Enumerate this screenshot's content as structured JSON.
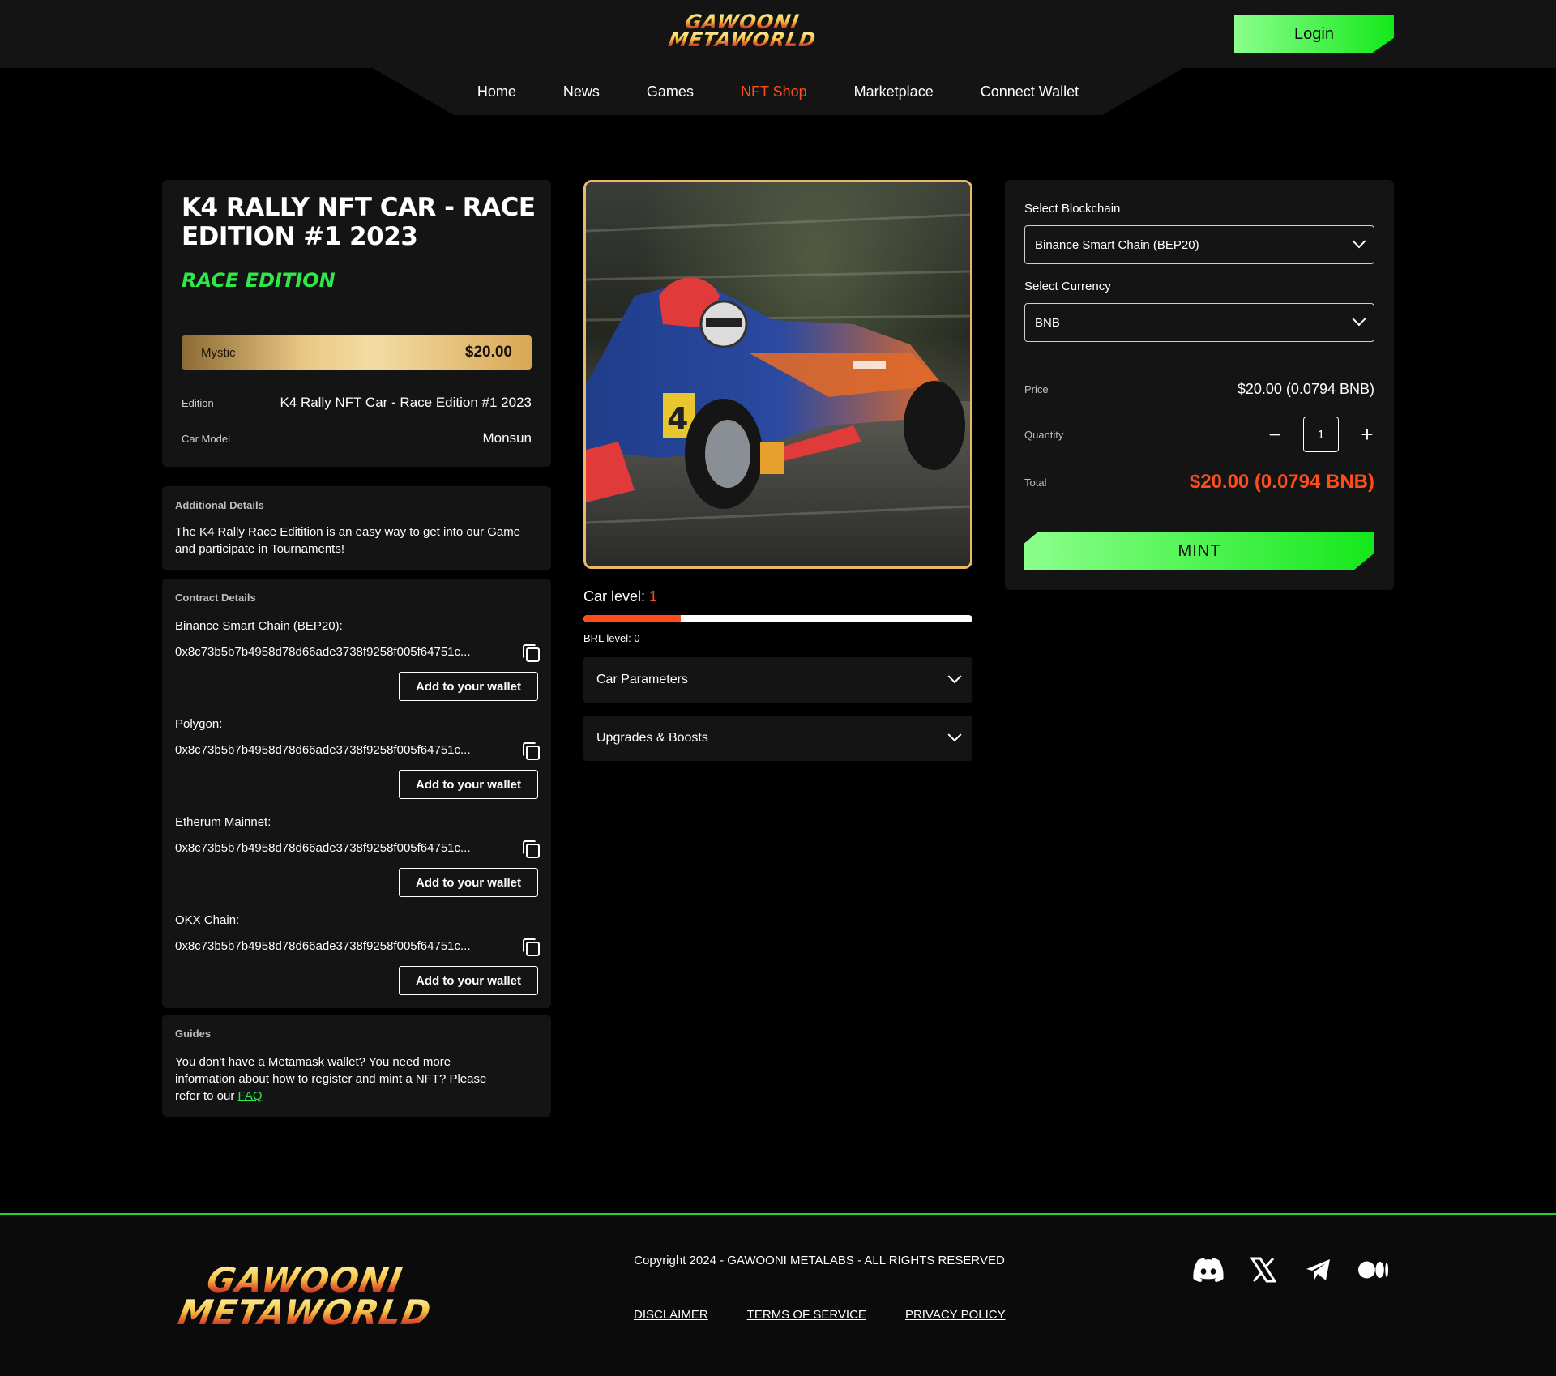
{
  "brand": {
    "logo_line1": "GAWOONI",
    "logo_line2": "METAWORLD"
  },
  "header": {
    "login_label": "Login"
  },
  "nav": {
    "items": [
      "Home",
      "News",
      "Games",
      "NFT Shop",
      "Marketplace",
      "Connect Wallet"
    ],
    "active": "NFT Shop"
  },
  "product": {
    "title": "K4 RALLY NFT CAR - RACE EDITION #1 2023",
    "edition_tag": "RACE EDITION",
    "rarity_name": "Mystic",
    "rarity_price": "$20.00",
    "edition_label": "Edition",
    "edition_value": "K4 Rally NFT Car - Race Edition #1 2023",
    "model_label": "Car Model",
    "model_value": "Monsun"
  },
  "additional": {
    "label": "Additional Details",
    "text": "The K4 Rally Race Editition is an easy way to get into our Game and participate in Tournaments!"
  },
  "contract": {
    "label": "Contract Details",
    "wallet_button": "Add to your wallet",
    "chains": [
      {
        "name": "Binance Smart Chain (BEP20):",
        "address": "0x8c73b5b7b4958d78d66ade3738f9258f005f64751c..."
      },
      {
        "name": "Polygon:",
        "address": "0x8c73b5b7b4958d78d66ade3738f9258f005f64751c..."
      },
      {
        "name": "Etherum Mainnet:",
        "address": "0x8c73b5b7b4958d78d66ade3738f9258f005f64751c..."
      },
      {
        "name": "OKX Chain:",
        "address": "0x8c73b5b7b4958d78d66ade3738f9258f005f64751c..."
      }
    ]
  },
  "guides": {
    "label": "Guides",
    "text": "You don't have a Metamask wallet? You need more information about how to register and mint a NFT? Please refer to our ",
    "link": "FAQ"
  },
  "car": {
    "level_label": "Car level: ",
    "level_value": "1",
    "level_progress": 0.25,
    "brl_label": "BRL level: 0",
    "accordions": [
      "Car Parameters",
      "Upgrades & Boosts"
    ]
  },
  "purchase": {
    "blockchain_label": "Select Blockchain",
    "blockchain_value": "Binance Smart Chain (BEP20)",
    "currency_label": "Select Currency",
    "currency_value": "BNB",
    "price_label": "Price",
    "price_value": "$20.00 (0.0794 BNB)",
    "quantity_label": "Quantity",
    "quantity_value": "1",
    "total_label": "Total",
    "total_value": "$20.00 (0.0794 BNB)",
    "mint_label": "MINT"
  },
  "footer": {
    "copyright": "Copyright 2024 - GAWOONI METALABS - ALL RIGHTS RESERVED",
    "links": [
      "DISCLAIMER",
      "TERMS OF SERVICE",
      "PRIVACY POLICY"
    ],
    "socials": [
      "discord-icon",
      "x-icon",
      "telegram-icon",
      "medium-icon"
    ]
  },
  "colors": {
    "accent_green": "#14e81b",
    "accent_orange": "#ff4d1a",
    "card_bg": "#141414",
    "gold": "#e9b86a"
  }
}
